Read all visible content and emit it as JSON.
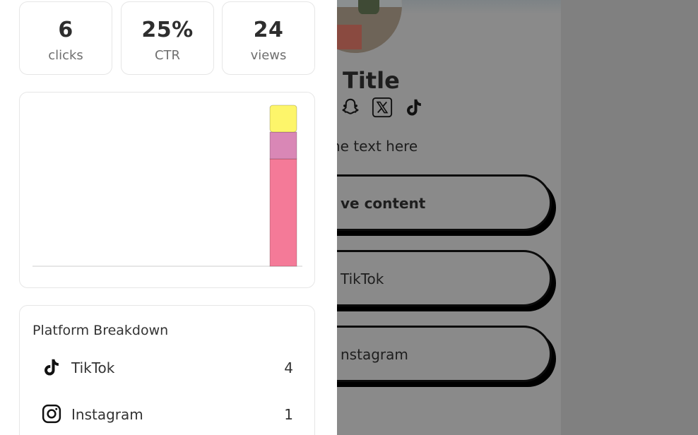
{
  "stats": {
    "clicks": {
      "value": "6",
      "label": "clicks"
    },
    "ctr": {
      "value": "25%",
      "label": "CTR"
    },
    "views": {
      "value": "24",
      "label": "views"
    }
  },
  "chart_data": {
    "type": "bar",
    "stacked": true,
    "grid": false,
    "categories": [
      "",
      "",
      "",
      "",
      "",
      "",
      "",
      ""
    ],
    "series": [
      {
        "values": [
          0,
          0,
          0,
          0,
          0,
          0,
          0,
          4
        ],
        "color": "#f47a98"
      },
      {
        "values": [
          0,
          0,
          0,
          0,
          0,
          0,
          0,
          1
        ],
        "color": "#d987b6"
      },
      {
        "values": [
          0,
          0,
          0,
          0,
          0,
          0,
          0,
          1
        ],
        "color": "#fdf56a"
      }
    ],
    "ylim": [
      0,
      6
    ]
  },
  "breakdown": {
    "title": "Platform Breakdown",
    "rows": [
      {
        "name": "TikTok",
        "count": "4",
        "icon": "tiktok-icon"
      },
      {
        "name": "Instagram",
        "count": "1",
        "icon": "instagram-icon"
      }
    ]
  },
  "preview": {
    "title": "Title",
    "bio": "ne text here",
    "social_icons": [
      "snapchat-icon",
      "x-icon",
      "tiktok-icon"
    ],
    "links": [
      {
        "label": "ve content"
      },
      {
        "label": "TikTok"
      },
      {
        "label": "nstagram"
      }
    ],
    "overlay_color": "#808080"
  }
}
